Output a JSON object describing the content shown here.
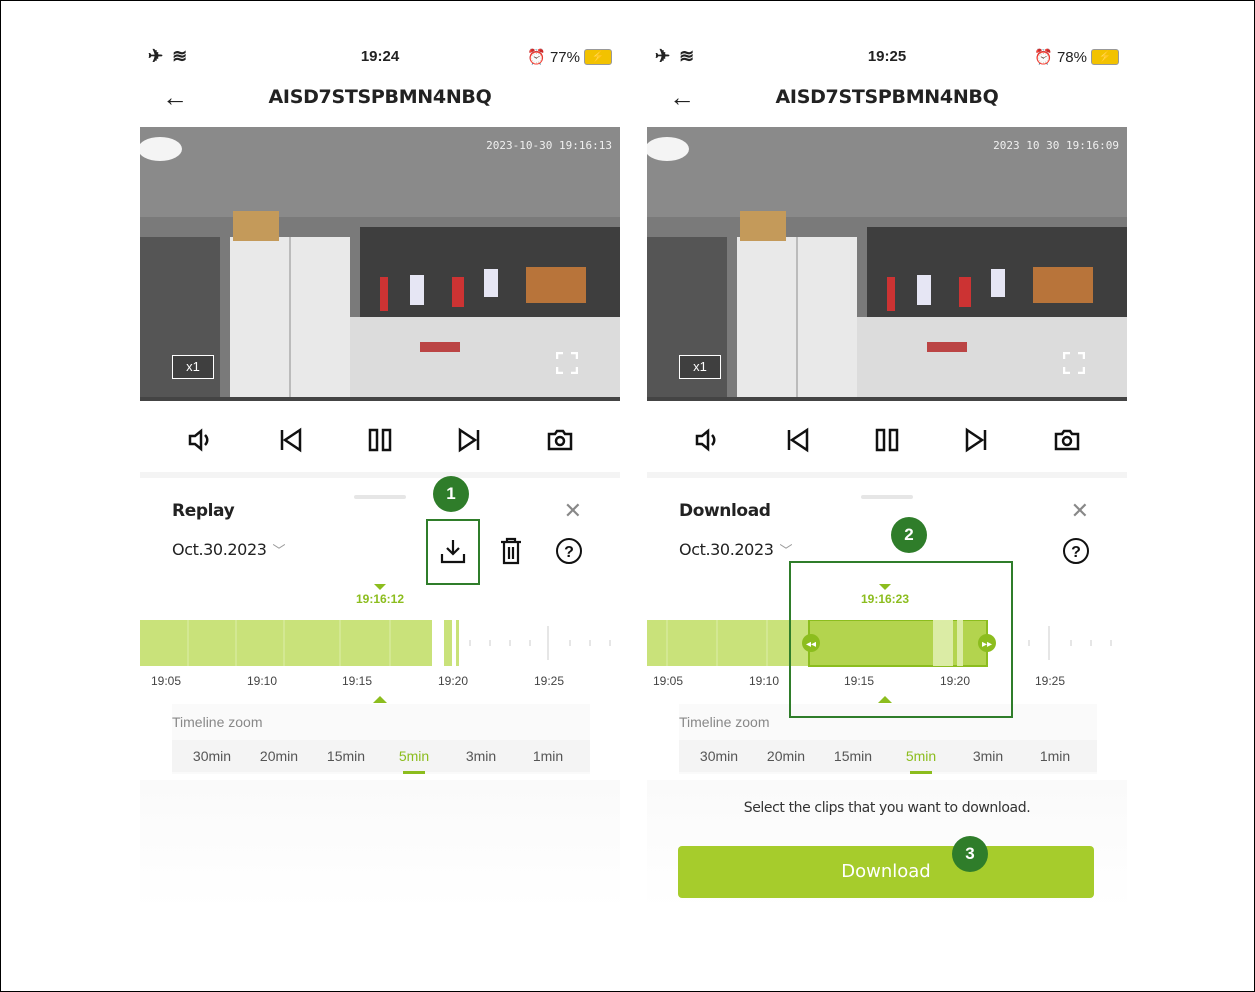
{
  "left": {
    "status": {
      "time": "19:24",
      "battery": "77%"
    },
    "device_title": "AISD7STSPBMN4NBQ",
    "video_timestamp": "2023-10-30 19:16:13",
    "zoom_badge": "x1",
    "panel": {
      "title": "Replay",
      "date": "Oct.30.2023"
    },
    "playhead_time": "19:16:12",
    "timeline_labels": [
      "19:05",
      "19:10",
      "19:15",
      "19:20",
      "19:25"
    ],
    "zoom_label": "Timeline zoom",
    "zoom_options": [
      "30min",
      "20min",
      "15min",
      "5min",
      "3min",
      "1min"
    ],
    "zoom_selected": "5min",
    "step_badge": "1"
  },
  "right": {
    "status": {
      "time": "19:25",
      "battery": "78%"
    },
    "device_title": "AISD7STSPBMN4NBQ",
    "video_timestamp": "2023 10 30 19:16:09",
    "zoom_badge": "x1",
    "panel": {
      "title": "Download",
      "date": "Oct.30.2023"
    },
    "playhead_time": "19:16:23",
    "timeline_labels": [
      "19:05",
      "19:10",
      "19:15",
      "19:20",
      "19:25"
    ],
    "zoom_label": "Timeline zoom",
    "zoom_options": [
      "30min",
      "20min",
      "15min",
      "5min",
      "3min",
      "1min"
    ],
    "zoom_selected": "5min",
    "hint": "Select the clips that you want to download.",
    "download_button": "Download",
    "step_badges": [
      "2",
      "3"
    ]
  },
  "colors": {
    "accent": "#8cbd1e",
    "button": "#a6cc2c",
    "badge": "#2f7d2a"
  }
}
